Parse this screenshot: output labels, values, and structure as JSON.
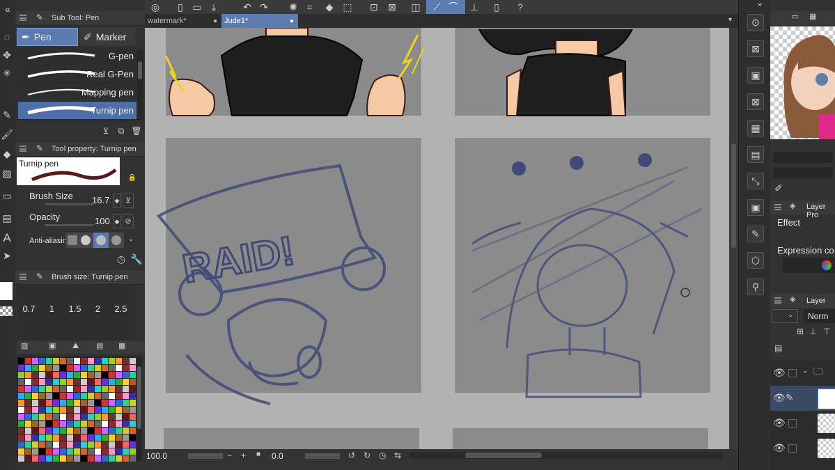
{
  "subtool_panel": {
    "header": "Sub Tool: Pen",
    "tabs": [
      {
        "label": "Pen",
        "active": true
      },
      {
        "label": "Marker",
        "active": false
      }
    ],
    "brushes": [
      {
        "label": "G-pen",
        "selected": false
      },
      {
        "label": "Real G-Pen",
        "selected": false
      },
      {
        "label": "Mapping pen",
        "selected": false
      },
      {
        "label": "Turnip pen",
        "selected": true
      }
    ]
  },
  "tool_property": {
    "header": "Tool property: Turnip pen",
    "preview_label": "Turnip pen",
    "brush_size_label": "Brush Size",
    "brush_size_value": "16.7",
    "opacity_label": "Opacity",
    "opacity_value": "100",
    "antialias_label": "Anti-aliasin"
  },
  "brush_size_panel": {
    "header": "Brush size: Turnip pen",
    "sizes": [
      "0.7",
      "1",
      "1.5",
      "2",
      "2.5"
    ]
  },
  "documents": {
    "tabs": [
      {
        "label": "watermark*",
        "active": false
      },
      {
        "label": "Jude1*",
        "active": true
      }
    ]
  },
  "canvas": {
    "raid_text": "RAID!"
  },
  "bottom_bar": {
    "zoom": "100.0",
    "rotation": "0.0"
  },
  "right_panel": {
    "layer_property_header": "Layer Pro",
    "effect_label": "Effect",
    "expression_label": "Expression co",
    "layer_header": "Layer",
    "blend_mode": "Norm"
  },
  "colors": {
    "accent": "#5b7bb3",
    "panel_bg": "#323232",
    "canvas_bg": "#b2b2b2",
    "frame_gray": "#8b8b8b",
    "sketch_blue": "#3f4a78"
  },
  "icons": [
    "undo-icon",
    "redo-icon",
    "search-icon",
    "layer-icon",
    "eye-icon",
    "pencil-icon",
    "folder-icon",
    "lock-icon",
    "settings-icon"
  ]
}
